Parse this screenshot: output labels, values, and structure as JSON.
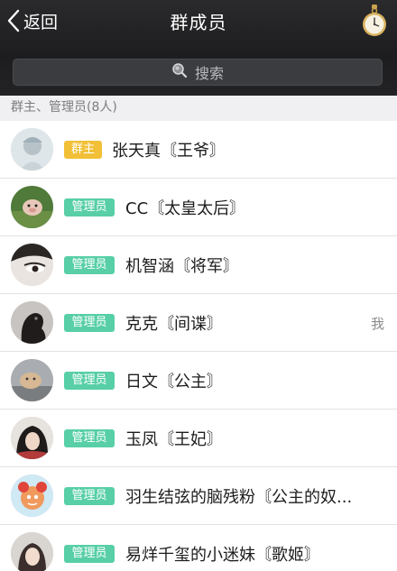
{
  "nav": {
    "back_label": "返回",
    "title": "群成员"
  },
  "search": {
    "placeholder": "搜索"
  },
  "section": {
    "header": "群主、管理员(8人)"
  },
  "members": [
    {
      "role": "群主",
      "name": "张天真〘王爷〙",
      "me": ""
    },
    {
      "role": "管理员",
      "name": "CC〘太皇太后〙",
      "me": ""
    },
    {
      "role": "管理员",
      "name": "机智涵〘将军〙",
      "me": ""
    },
    {
      "role": "管理员",
      "name": "克克〘间谍〙",
      "me": "我"
    },
    {
      "role": "管理员",
      "name": "日文〘公主〙",
      "me": ""
    },
    {
      "role": "管理员",
      "name": "玉凤〘王妃〙",
      "me": ""
    },
    {
      "role": "管理员",
      "name": "羽生结弦的脑残粉〘公主的奴...",
      "me": ""
    },
    {
      "role": "管理员",
      "name": "易烊千玺的小迷妹〘歌姬〙",
      "me": ""
    }
  ],
  "colors": {
    "owner_badge": "#f2c037",
    "admin_badge": "#58cfa6",
    "header_bg": "#1d1d1f"
  },
  "icons": {
    "back": "chevron-left-icon",
    "watch": "pocket-watch-icon",
    "search": "magnifier-icon"
  }
}
